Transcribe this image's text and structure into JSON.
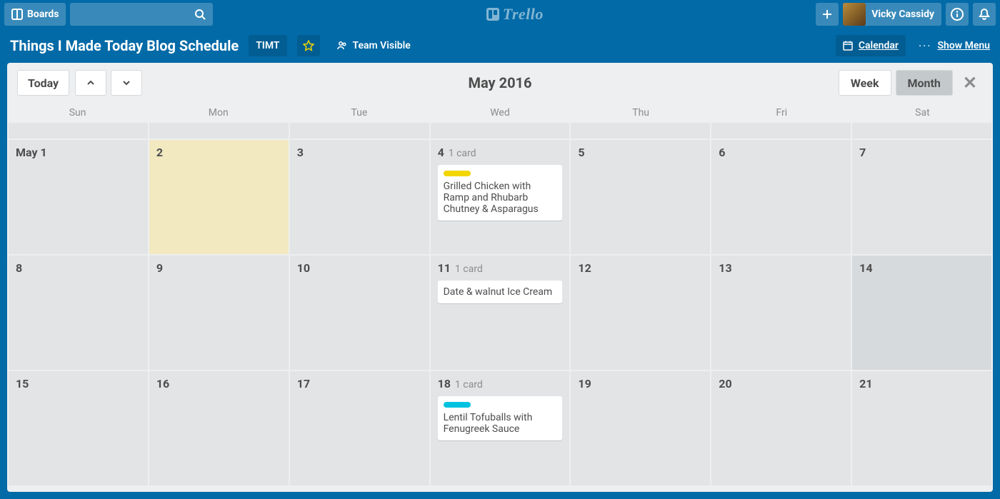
{
  "topbar": {
    "boards_label": "Boards",
    "logo_text": "Trello",
    "user_name": "Vicky Cassidy"
  },
  "board": {
    "title": "Things I Made Today Blog Schedule",
    "team_short": "TIMT",
    "visibility": "Team Visible",
    "calendar_label": "Calendar",
    "show_menu_label": "Show Menu"
  },
  "calendar": {
    "today_label": "Today",
    "title": "May 2016",
    "week_label": "Week",
    "month_label": "Month",
    "dow": [
      "Sun",
      "Mon",
      "Tue",
      "Wed",
      "Thu",
      "Fri",
      "Sat"
    ],
    "weeks": [
      {
        "days": [
          {
            "label": "May 1"
          },
          {
            "label": "2",
            "today": true
          },
          {
            "label": "3"
          },
          {
            "label": "4",
            "count": "1 card",
            "cards": [
              {
                "color": "#f2d600",
                "title": "Grilled Chicken with Ramp and Rhubarb Chutney & Asparagus"
              }
            ]
          },
          {
            "label": "5"
          },
          {
            "label": "6"
          },
          {
            "label": "7"
          }
        ]
      },
      {
        "days": [
          {
            "label": "8"
          },
          {
            "label": "9"
          },
          {
            "label": "10"
          },
          {
            "label": "11",
            "count": "1 card",
            "cards": [
              {
                "color": null,
                "title": "Date & walnut Ice Cream"
              }
            ]
          },
          {
            "label": "12"
          },
          {
            "label": "13"
          },
          {
            "label": "14",
            "highlight": true
          }
        ]
      },
      {
        "days": [
          {
            "label": "15"
          },
          {
            "label": "16"
          },
          {
            "label": "17"
          },
          {
            "label": "18",
            "count": "1 card",
            "cards": [
              {
                "color": "#00c2e0",
                "title": "Lentil Tofuballs with Fenugreek Sauce"
              }
            ]
          },
          {
            "label": "19"
          },
          {
            "label": "20"
          },
          {
            "label": "21"
          }
        ]
      }
    ]
  }
}
